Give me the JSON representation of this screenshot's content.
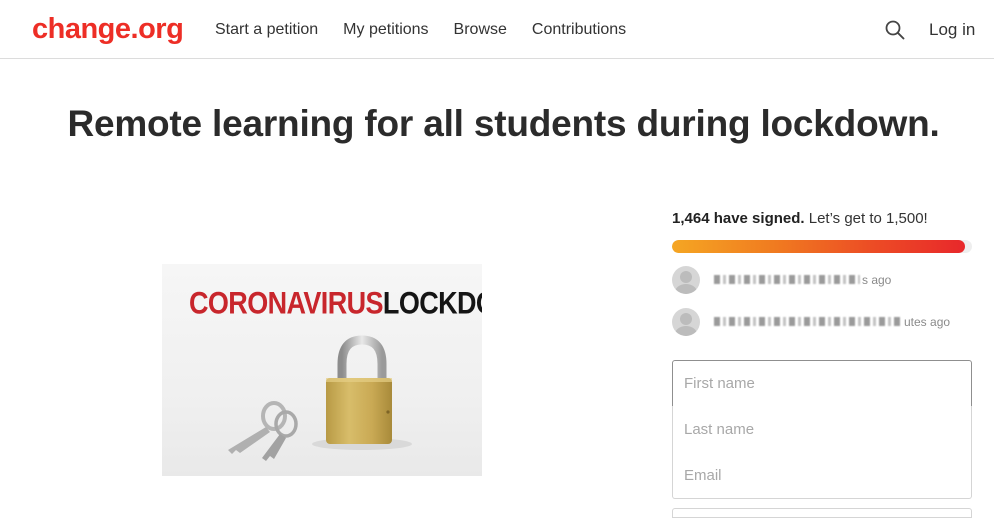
{
  "header": {
    "logo": "change.org",
    "nav": [
      "Start a petition",
      "My petitions",
      "Browse",
      "Contributions"
    ],
    "search_icon": "search-icon",
    "login_label": "Log in"
  },
  "petition": {
    "title": "Remote learning for all students during lockdown.",
    "image": {
      "headline_red": "CORONAVIRUS",
      "headline_dark": "LOCKDOWN",
      "depicts": "padlock-and-keys"
    }
  },
  "progress": {
    "signed_count": "1,464 have signed.",
    "goal_text": " Let’s get to 1,500!",
    "signed": 1464,
    "goal": 1500,
    "bar_gradient": [
      "#f5a623",
      "#ec4a25",
      "#e8282b"
    ]
  },
  "recent_signers": [
    {
      "name": "██████ ███ ██ ████",
      "time": "s ago"
    },
    {
      "name": "████████ ████ ██ ███ █ ███",
      "time": "utes ago"
    }
  ],
  "form": {
    "first_name_placeholder": "First name",
    "last_name_placeholder": "Last name",
    "email_placeholder": "Email"
  },
  "colors": {
    "brand": "#ed2e26",
    "text": "#282828",
    "muted": "#8a8a8a"
  }
}
